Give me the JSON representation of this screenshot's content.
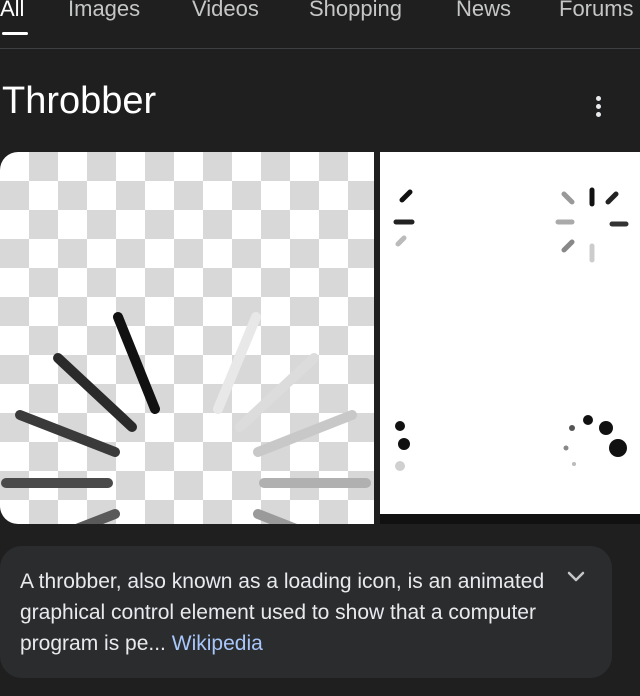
{
  "tabs": [
    {
      "label": "All",
      "active": true
    },
    {
      "label": "Images",
      "active": false
    },
    {
      "label": "Videos",
      "active": false
    },
    {
      "label": "Shopping",
      "active": false
    },
    {
      "label": "News",
      "active": false
    },
    {
      "label": "Forums",
      "active": false
    }
  ],
  "title": "Throbber",
  "more_icon": "more-vert-icon",
  "images": [
    {
      "name": "spinner-image"
    },
    {
      "name": "spinner-samples-image"
    }
  ],
  "description": {
    "text": "A throbber, also known as a loading icon, is an animated graphical control element used to show that a computer program is pe...",
    "source": "Wikipedia",
    "expand_icon": "chevron-down-icon"
  },
  "colors": {
    "background": "#1f1f1f",
    "card": "#2b2c2e",
    "link": "#a8c7fa"
  }
}
